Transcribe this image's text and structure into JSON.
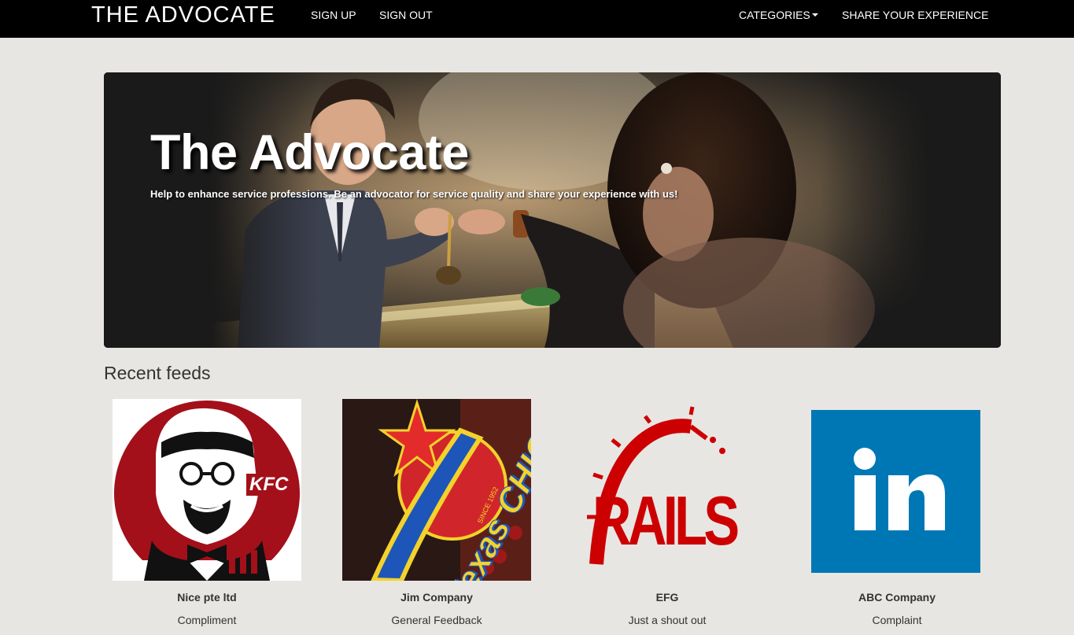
{
  "navbar": {
    "brand": "THE ADVOCATE",
    "links": {
      "sign_up": "SIGN UP",
      "sign_out": "SIGN OUT",
      "categories": "CATEGORIES",
      "share": "SHARE YOUR EXPERIENCE"
    }
  },
  "hero": {
    "title": "The Advocate",
    "subtitle": "Help to enhance service professions. Be an advocator for service quality and share your experience with us!"
  },
  "feeds": {
    "title": "Recent feeds",
    "items": [
      {
        "name": "Nice pte ltd",
        "type": "Compliment",
        "logo": "kfc-logo",
        "logo_text": "KFC"
      },
      {
        "name": "Jim Company",
        "type": "General Feedback",
        "logo": "texas-chicken-logo",
        "logo_text": "Texas CHICKEN",
        "logo_subtext": "SINCE 1952"
      },
      {
        "name": "EFG",
        "type": "Just a shout out",
        "logo": "rails-logo",
        "logo_text": "RAILS"
      },
      {
        "name": "ABC Company",
        "type": "Complaint",
        "logo": "linkedin-logo",
        "logo_text": "in"
      }
    ]
  },
  "colors": {
    "navbar_bg": "#000000",
    "page_bg": "#e8e6e3",
    "kfc_red": "#a3101a",
    "rails_red": "#cc0000",
    "linkedin_blue": "#0077b5"
  }
}
